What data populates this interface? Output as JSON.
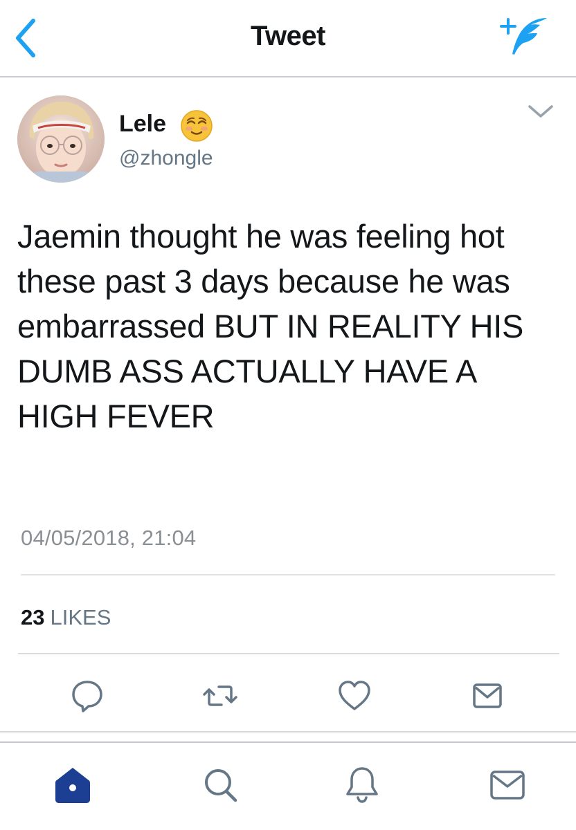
{
  "navbar": {
    "title": "Tweet",
    "back_icon": "chevron-left-icon",
    "compose_icon": "compose-tweet-icon"
  },
  "tweet": {
    "author": {
      "display_name": "Lele",
      "emoji_icon": "smiling-face-icon",
      "handle": "@zhongle",
      "avatar_icon": "user-avatar-photo"
    },
    "menu_icon": "chevron-down-icon",
    "text": "Jaemin thought he was feeling hot these past 3 days because he was embarrassed BUT IN REALITY HIS DUMB ASS ACTUALLY HAVE A HIGH FEVER",
    "timestamp": "04/05/2018, 21:04",
    "likes": {
      "count": "23",
      "label": "LIKES"
    }
  },
  "actions": [
    {
      "name": "reply",
      "icon": "reply-icon"
    },
    {
      "name": "retweet",
      "icon": "retweet-icon"
    },
    {
      "name": "like",
      "icon": "heart-icon"
    },
    {
      "name": "direct-message",
      "icon": "envelope-icon"
    }
  ],
  "tabbar": [
    {
      "name": "home",
      "icon": "home-icon",
      "active": true
    },
    {
      "name": "search",
      "icon": "search-icon",
      "active": false
    },
    {
      "name": "notifications",
      "icon": "bell-icon",
      "active": false
    },
    {
      "name": "messages",
      "icon": "envelope-icon",
      "active": false
    }
  ],
  "colors": {
    "accent": "#1da1f2",
    "active_tab": "#1c3f94",
    "icon_gray": "#657786",
    "text_primary": "#14171a",
    "text_secondary": "#657786"
  }
}
